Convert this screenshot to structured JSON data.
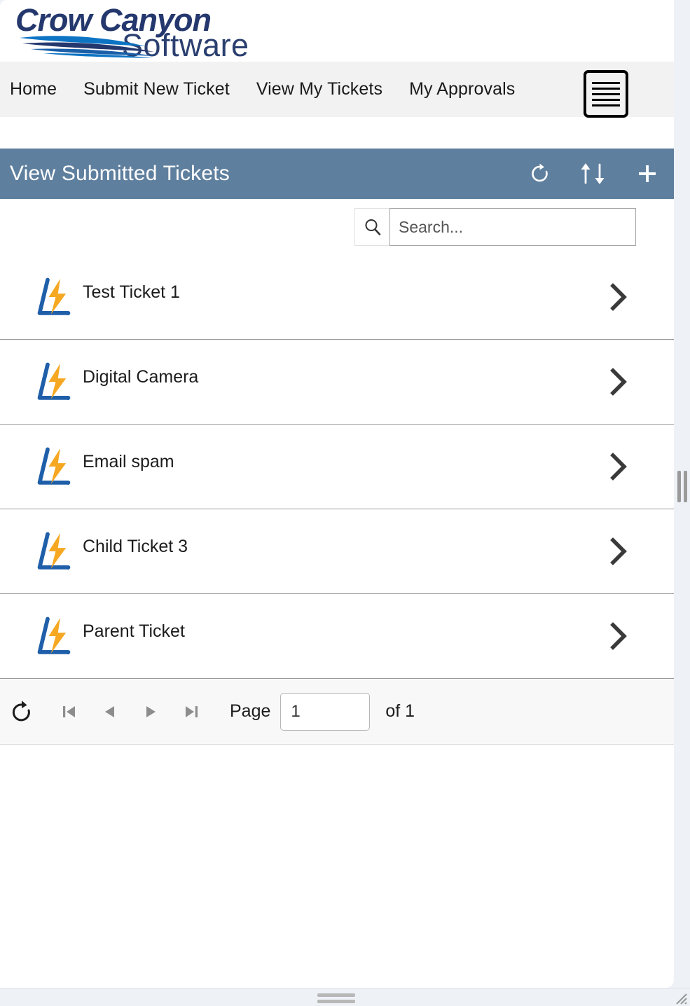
{
  "brand": {
    "logo_line1": "Crow Canyon",
    "logo_line2": "Software",
    "logo_navy": "#24386e",
    "logo_blue": "#0d74c4"
  },
  "nav": {
    "items": [
      {
        "label": "Home"
      },
      {
        "label": "Submit New Ticket"
      },
      {
        "label": "View My Tickets"
      },
      {
        "label": "My Approvals"
      }
    ],
    "menu_icon": "hamburger-icon"
  },
  "section": {
    "title": "View Submitted Tickets",
    "background": "#5f7f9e",
    "actions": [
      {
        "name": "refresh-icon"
      },
      {
        "name": "sort-icon"
      },
      {
        "name": "add-icon"
      }
    ]
  },
  "search": {
    "icon": "search-icon",
    "placeholder": "Search...",
    "value": ""
  },
  "tickets": [
    {
      "title": "Test Ticket 1",
      "icon": "lightning-ticket-icon",
      "chevron": "chevron-right-icon"
    },
    {
      "title": "Digital Camera",
      "icon": "lightning-ticket-icon",
      "chevron": "chevron-right-icon"
    },
    {
      "title": "Email spam",
      "icon": "lightning-ticket-icon",
      "chevron": "chevron-right-icon"
    },
    {
      "title": "Child Ticket 3",
      "icon": "lightning-ticket-icon",
      "chevron": "chevron-right-icon"
    },
    {
      "title": "Parent Ticket",
      "icon": "lightning-ticket-icon",
      "chevron": "chevron-right-icon"
    }
  ],
  "pager": {
    "refresh_icon": "refresh-icon",
    "first_icon": "first-page-icon",
    "prev_icon": "previous-page-icon",
    "next_icon": "next-page-icon",
    "last_icon": "last-page-icon",
    "page_label": "Page",
    "page_value": "1",
    "of_label": "of 1"
  },
  "icon_colors": {
    "ticket_blue": "#1f5fa9",
    "ticket_orange": "#f6a823"
  }
}
